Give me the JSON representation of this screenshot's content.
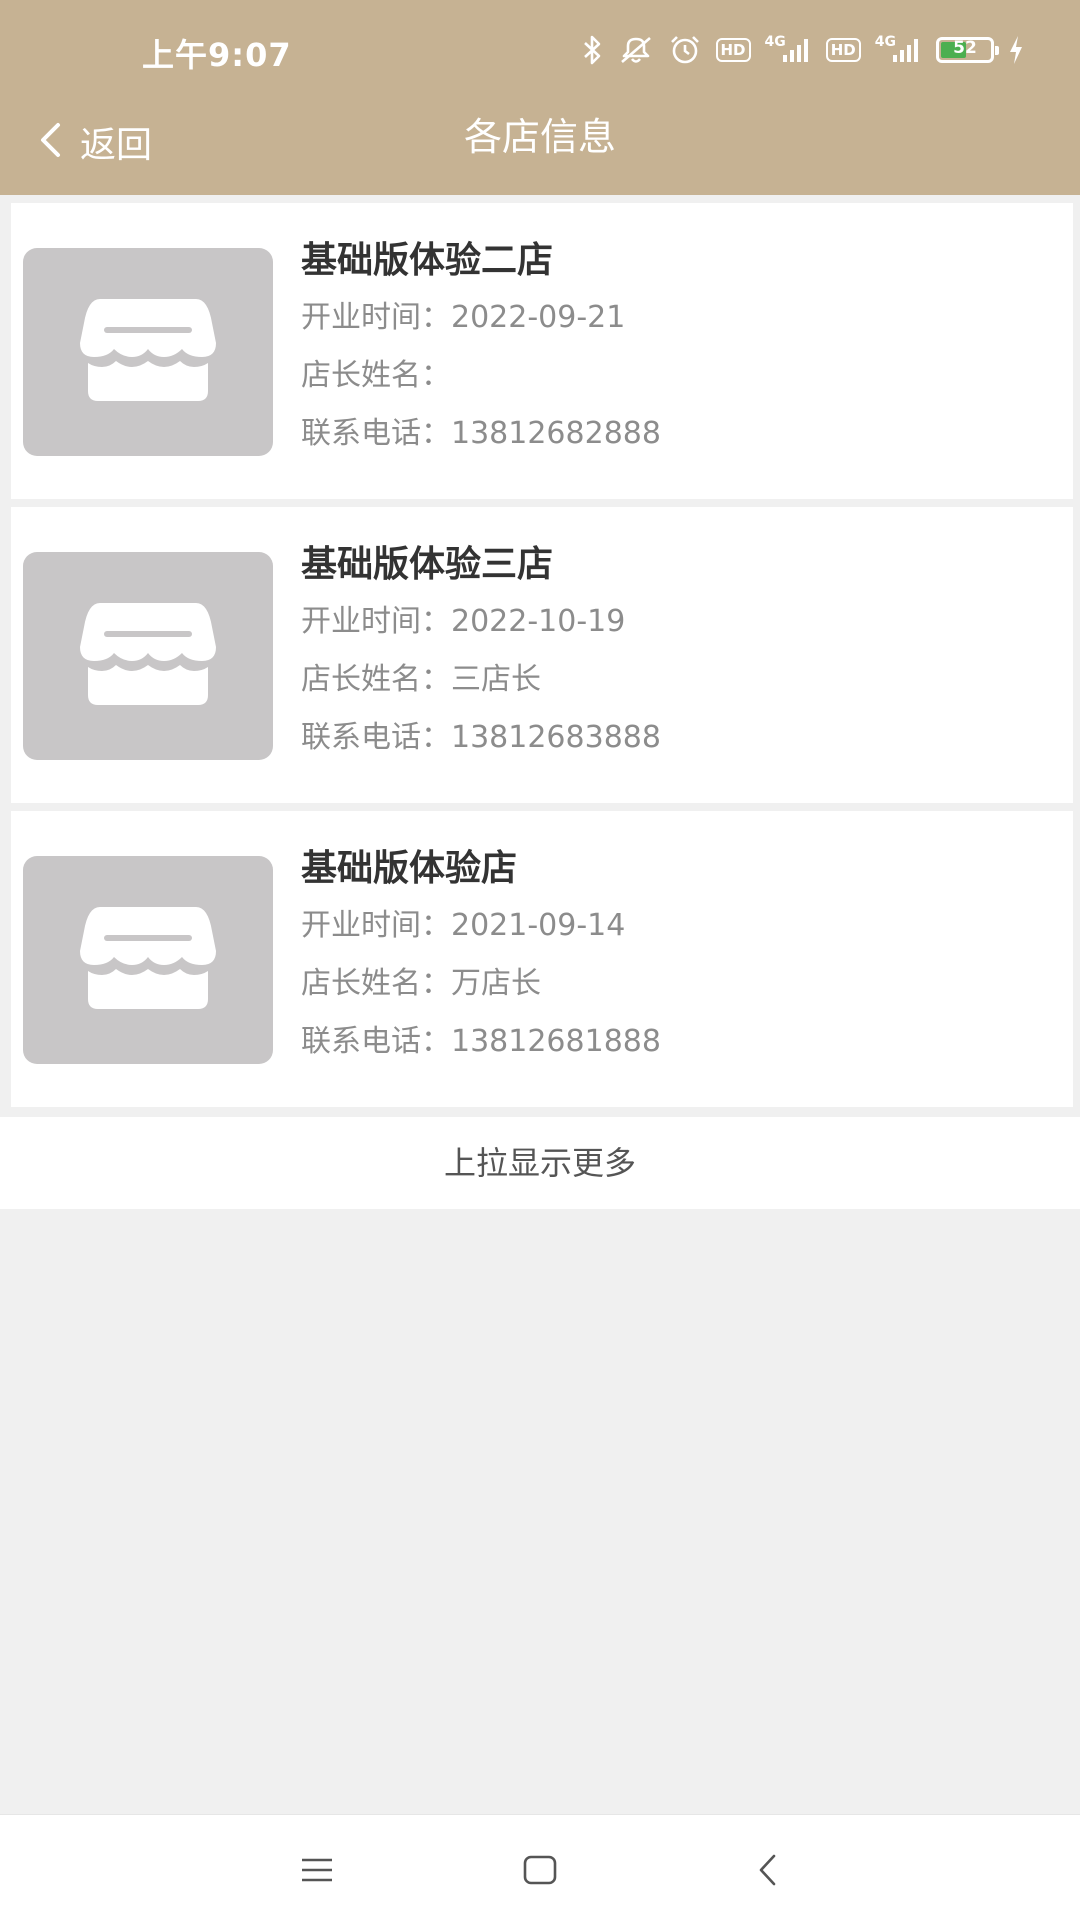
{
  "status_bar": {
    "time": "上午9:07",
    "hd1": "HD",
    "hd2": "HD",
    "net1": "4G",
    "net2": "4G",
    "battery": "52",
    "icons": [
      "bluetooth-icon",
      "mute-icon",
      "alarm-icon",
      "hd-badge",
      "signal-icon",
      "hd-badge",
      "signal-icon",
      "battery-icon",
      "charging-icon"
    ]
  },
  "nav": {
    "back_label": "返回",
    "title": "各店信息"
  },
  "stores": [
    {
      "name": "基础版体验二店",
      "open_label": "开业时间：",
      "open_date": "2022-09-21",
      "manager_label": "店长姓名：",
      "manager": "",
      "phone_label": "联系电话：",
      "phone": "13812682888"
    },
    {
      "name": "基础版体验三店",
      "open_label": "开业时间：",
      "open_date": "2022-10-19",
      "manager_label": "店长姓名：",
      "manager": "三店长",
      "phone_label": "联系电话：",
      "phone": "13812683888"
    },
    {
      "name": "基础版体验店",
      "open_label": "开业时间：",
      "open_date": "2021-09-14",
      "manager_label": "店长姓名：",
      "manager": "万店长",
      "phone_label": "联系电话：",
      "phone": "13812681888"
    }
  ],
  "load_more": "上拉显示更多",
  "colors": {
    "header": "#c6b293",
    "thumb": "#c8c6c7",
    "background": "#f0f0f0"
  }
}
